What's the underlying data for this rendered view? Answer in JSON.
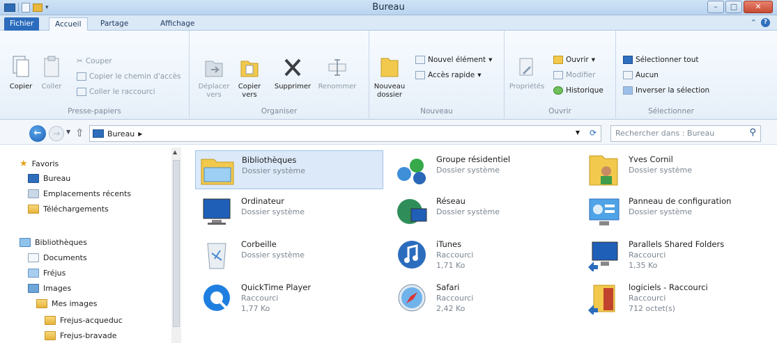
{
  "window": {
    "title": "Bureau"
  },
  "tabs": {
    "file": "Fichier",
    "home": "Accueil",
    "share": "Partage",
    "view": "Affichage"
  },
  "ribbon": {
    "clipboard": {
      "label": "Presse-papiers",
      "copy": "Copier",
      "paste": "Coller",
      "cut": "Couper",
      "copy_path": "Copier le chemin d'accès",
      "paste_shortcut": "Coller le raccourci"
    },
    "organize": {
      "label": "Organiser",
      "move_to": "Déplacer vers",
      "copy_to": "Copier vers",
      "delete": "Supprimer",
      "rename": "Renommer"
    },
    "new": {
      "label": "Nouveau",
      "new_folder": "Nouveau dossier",
      "new_item": "Nouvel élément",
      "easy_access": "Accès rapide"
    },
    "open": {
      "label": "Ouvrir",
      "properties": "Propriétés",
      "open": "Ouvrir",
      "edit": "Modifier",
      "history": "Historique"
    },
    "select": {
      "label": "Sélectionner",
      "select_all": "Sélectionner tout",
      "select_none": "Aucun",
      "invert": "Inverser la sélection"
    }
  },
  "address": {
    "crumb": "Bureau",
    "search_placeholder": "Rechercher dans : Bureau"
  },
  "sidebar": {
    "favorites": "Favoris",
    "desktop": "Bureau",
    "recent": "Emplacements récents",
    "downloads": "Téléchargements",
    "libraries": "Bibliothèques",
    "documents": "Documents",
    "frejus": "Fréjus",
    "images": "Images",
    "my_images": "Mes images",
    "frejus_acq": "Frejus-acqueduc",
    "frejus_brav": "Frejus-bravade"
  },
  "items": [
    {
      "name": "Bibliothèques",
      "line1": "Dossier système",
      "line2": ""
    },
    {
      "name": "Groupe résidentiel",
      "line1": "Dossier système",
      "line2": ""
    },
    {
      "name": "Yves Cornil",
      "line1": "Dossier système",
      "line2": ""
    },
    {
      "name": "Ordinateur",
      "line1": "Dossier système",
      "line2": ""
    },
    {
      "name": "Réseau",
      "line1": "Dossier système",
      "line2": ""
    },
    {
      "name": "Panneau de configuration",
      "line1": "Dossier système",
      "line2": ""
    },
    {
      "name": "Corbeille",
      "line1": "Dossier système",
      "line2": ""
    },
    {
      "name": "iTunes",
      "line1": "Raccourci",
      "line2": "1,71 Ko"
    },
    {
      "name": "Parallels Shared Folders",
      "line1": "Raccourci",
      "line2": "1,35 Ko"
    },
    {
      "name": "QuickTime Player",
      "line1": "Raccourci",
      "line2": "1,77 Ko"
    },
    {
      "name": "Safari",
      "line1": "Raccourci",
      "line2": "2,42 Ko"
    },
    {
      "name": "logiciels - Raccourci",
      "line1": "Raccourci",
      "line2": "712 octet(s)"
    }
  ]
}
